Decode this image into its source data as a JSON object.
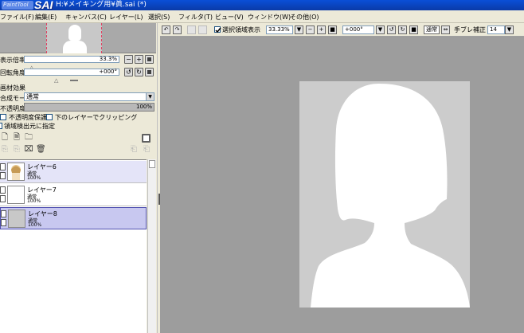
{
  "titlebar": {
    "logo_small": "PaintTool",
    "logo_big": "SAI",
    "title": "H:¥メイキング用¥眞.sai (*)"
  },
  "menu": [
    {
      "label": "ファイル(F)"
    },
    {
      "label": "編集(E)"
    },
    {
      "label": "キャンバス(C)"
    },
    {
      "label": "レイヤー(L)"
    },
    {
      "label": "選択(S)"
    },
    {
      "label": "フィルタ(T)"
    },
    {
      "label": "ビュー(V)"
    },
    {
      "label": "ウィンドウ(W)"
    },
    {
      "label": "その他(O)"
    }
  ],
  "navigator": {
    "zoom_label": "表示倍率",
    "zoom_value": "33.3%",
    "angle_label": "回転角度",
    "angle_value": "+000°"
  },
  "effects": {
    "section_label": "画材効果",
    "blend_label": "合成モード",
    "blend_value": "通常",
    "opacity_label": "不透明度",
    "opacity_value": "100%",
    "opacity_fraction": 1.0,
    "protect_label": "不透明度保護",
    "clip_label": "下のレイヤーでクリッピング",
    "source_label": "領域検出元に指定"
  },
  "layers": [
    {
      "name": "レイヤー6",
      "mode": "通常",
      "opacity": "100%"
    },
    {
      "name": "レイヤー7",
      "mode": "通常",
      "opacity": "100%"
    },
    {
      "name": "レイヤー8",
      "mode": "通常",
      "opacity": "100%"
    }
  ],
  "canvas_toolbar": {
    "selection_label": "選択領域表示",
    "zoom_value": "33.33%",
    "angle_value": "+000°",
    "mode_label": "通常",
    "stabilizer_label": "手ブレ補正",
    "stabilizer_value": "14"
  },
  "colors": {
    "titlebar": "#0a4fd8",
    "panel": "#ece9d8",
    "canvas_bg": "#9d9d9d",
    "artboard": "#cccccc",
    "silhouette": "#ffffff",
    "selected_layer": "#c8c8f0"
  }
}
